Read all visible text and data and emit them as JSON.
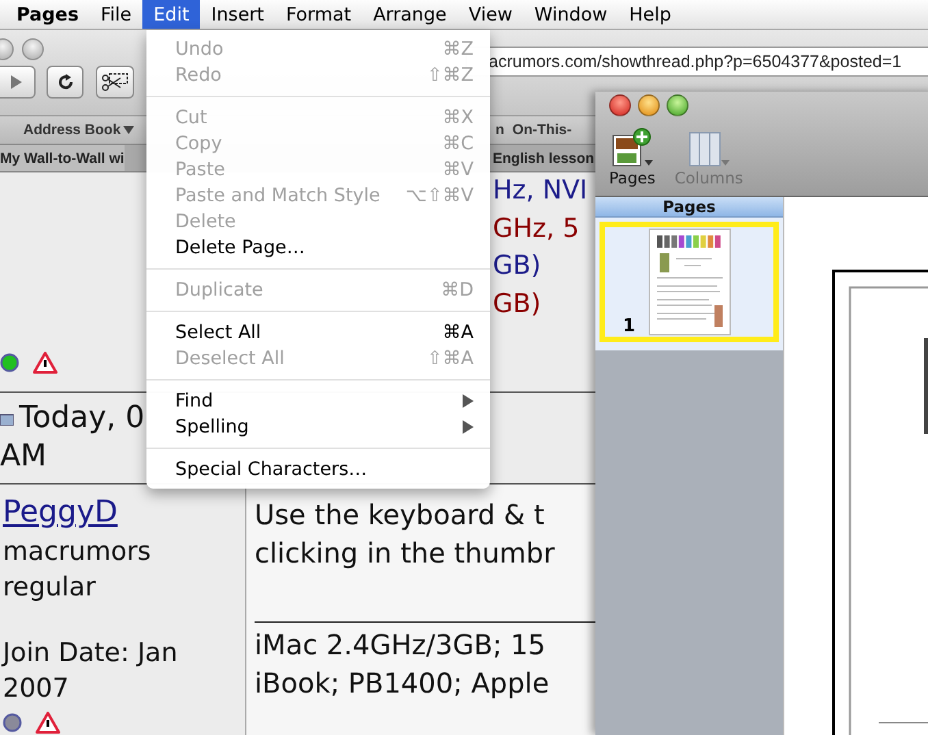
{
  "menu_bar": {
    "items": [
      {
        "label": "Pages",
        "kind": "app",
        "selected": false
      },
      {
        "label": "File",
        "kind": "menu",
        "selected": false
      },
      {
        "label": "Edit",
        "kind": "menu",
        "selected": true
      },
      {
        "label": "Insert",
        "kind": "menu",
        "selected": false
      },
      {
        "label": "Format",
        "kind": "menu",
        "selected": false
      },
      {
        "label": "Arrange",
        "kind": "menu",
        "selected": false
      },
      {
        "label": "View",
        "kind": "menu",
        "selected": false
      },
      {
        "label": "Window",
        "kind": "menu",
        "selected": false
      },
      {
        "label": "Help",
        "kind": "menu",
        "selected": false
      }
    ]
  },
  "browser": {
    "url": "acrumors.com/showthread.php?p=6504377&posted=1",
    "bookmarks": [
      {
        "label": "Address Book",
        "kind": "folder"
      },
      {
        "label": "n",
        "kind": "link"
      },
      {
        "label": "On-This-",
        "kind": "link"
      }
    ],
    "tabs": [
      {
        "label": "My Wall-to-Wall wi",
        "selected": true
      },
      {
        "label": "English lesson",
        "selected": false
      }
    ],
    "spec_lines": [
      {
        "text": "Hz, NVI",
        "color": "#1c1c8a"
      },
      {
        "text": "GHz, 5",
        "color": "#8a0000"
      },
      {
        "text": "GB)",
        "color": "#1c1c8a"
      },
      {
        "text": "GB)",
        "color": "#8a0000"
      }
    ],
    "previous_post": {
      "online": true
    },
    "post": {
      "date": "Today, 0",
      "time": "AM",
      "user": {
        "name": "PeggyD",
        "title": "macrumors regular",
        "join_date": "Join Date: Jan 2007",
        "online": false
      },
      "message_lines": [
        "Use the keyboard & t",
        "clicking in the thumbr"
      ],
      "signature_lines": [
        "iMac 2.4GHz/3GB; 15",
        "iBook; PB1400; Apple"
      ]
    }
  },
  "pages_window": {
    "toolbar": [
      {
        "label": "Pages",
        "kind": "pages",
        "disabled": false
      },
      {
        "label": "Columns",
        "kind": "columns",
        "disabled": true
      }
    ],
    "sidebar": {
      "title": "Pages",
      "thumbnails": [
        {
          "number": "1",
          "selected": true
        }
      ]
    }
  },
  "edit_menu": {
    "items": [
      {
        "kind": "item",
        "label": "Undo",
        "shortcut": "⌘Z",
        "disabled": true
      },
      {
        "kind": "item",
        "label": "Redo",
        "shortcut": "⇧⌘Z",
        "disabled": true
      },
      {
        "kind": "separator"
      },
      {
        "kind": "item",
        "label": "Cut",
        "shortcut": "⌘X",
        "disabled": true
      },
      {
        "kind": "item",
        "label": "Copy",
        "shortcut": "⌘C",
        "disabled": true
      },
      {
        "kind": "item",
        "label": "Paste",
        "shortcut": "⌘V",
        "disabled": true
      },
      {
        "kind": "item",
        "label": "Paste and Match Style",
        "shortcut": "⌥⇧⌘V",
        "disabled": true
      },
      {
        "kind": "item",
        "label": "Delete",
        "disabled": true
      },
      {
        "kind": "item",
        "label": "Delete Page…",
        "disabled": false
      },
      {
        "kind": "separator"
      },
      {
        "kind": "item",
        "label": "Duplicate",
        "shortcut": "⌘D",
        "disabled": true
      },
      {
        "kind": "separator"
      },
      {
        "kind": "item",
        "label": "Select All",
        "shortcut": "⌘A",
        "disabled": false
      },
      {
        "kind": "item",
        "label": "Deselect All",
        "shortcut": "⇧⌘A",
        "disabled": true
      },
      {
        "kind": "separator"
      },
      {
        "kind": "item",
        "label": "Find",
        "disabled": false,
        "submenu": true
      },
      {
        "kind": "item",
        "label": "Spelling",
        "disabled": false,
        "submenu": true
      },
      {
        "kind": "separator"
      },
      {
        "kind": "item",
        "label": "Special Characters…",
        "disabled": false
      }
    ]
  }
}
